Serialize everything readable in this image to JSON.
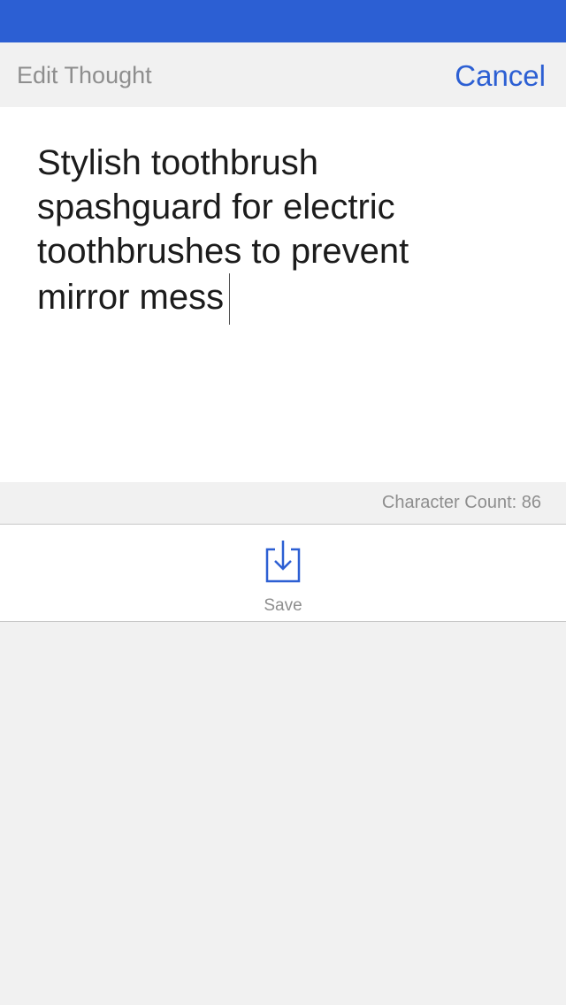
{
  "status_bar": {
    "color": "#2c5fd3"
  },
  "nav": {
    "title": "Edit Thought",
    "cancel_label": "Cancel",
    "accent_color": "#2c5fd3"
  },
  "editor": {
    "text": "Stylish toothbrush spashguard for electric toothbrushes to prevent mirror mess"
  },
  "counter": {
    "label": "Character Count: 86"
  },
  "toolbar": {
    "save_label": "Save",
    "save_icon": "save-download-icon"
  }
}
